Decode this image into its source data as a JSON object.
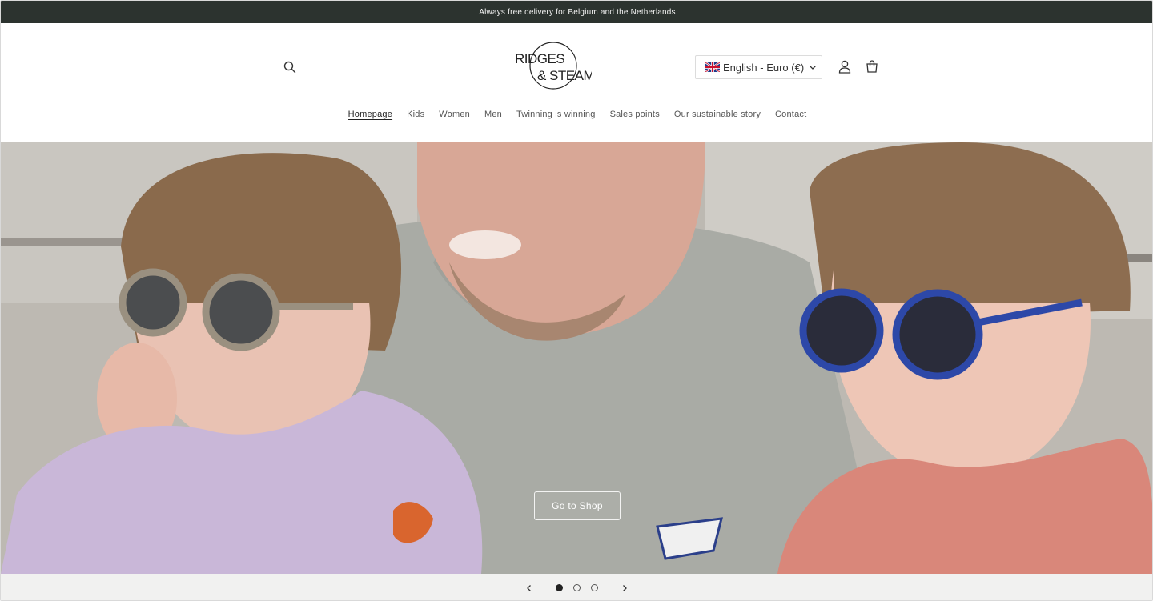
{
  "announcement": {
    "text": "Always free delivery for Belgium and the Netherlands"
  },
  "header": {
    "logo_text_line1": "RIDGES",
    "logo_text_line2": "& STEAM",
    "locale_label": "English - Euro (€)"
  },
  "nav": {
    "items": [
      {
        "label": "Homepage",
        "active": true
      },
      {
        "label": "Kids"
      },
      {
        "label": "Women"
      },
      {
        "label": "Men"
      },
      {
        "label": "Twinning is winning"
      },
      {
        "label": "Sales points"
      },
      {
        "label": "Our sustainable story"
      },
      {
        "label": "Contact"
      }
    ]
  },
  "hero": {
    "cta_label": "Go to Shop"
  },
  "slider": {
    "slide_count": 3,
    "current_slide": 1
  },
  "icons": [
    "search-icon",
    "uk-flag-icon",
    "chevron-down-icon",
    "account-icon",
    "cart-icon",
    "chevron-left-icon",
    "chevron-right-icon"
  ],
  "colors": {
    "announcement_bg": "#2c332f",
    "slider_bg": "#f1f1f0"
  }
}
